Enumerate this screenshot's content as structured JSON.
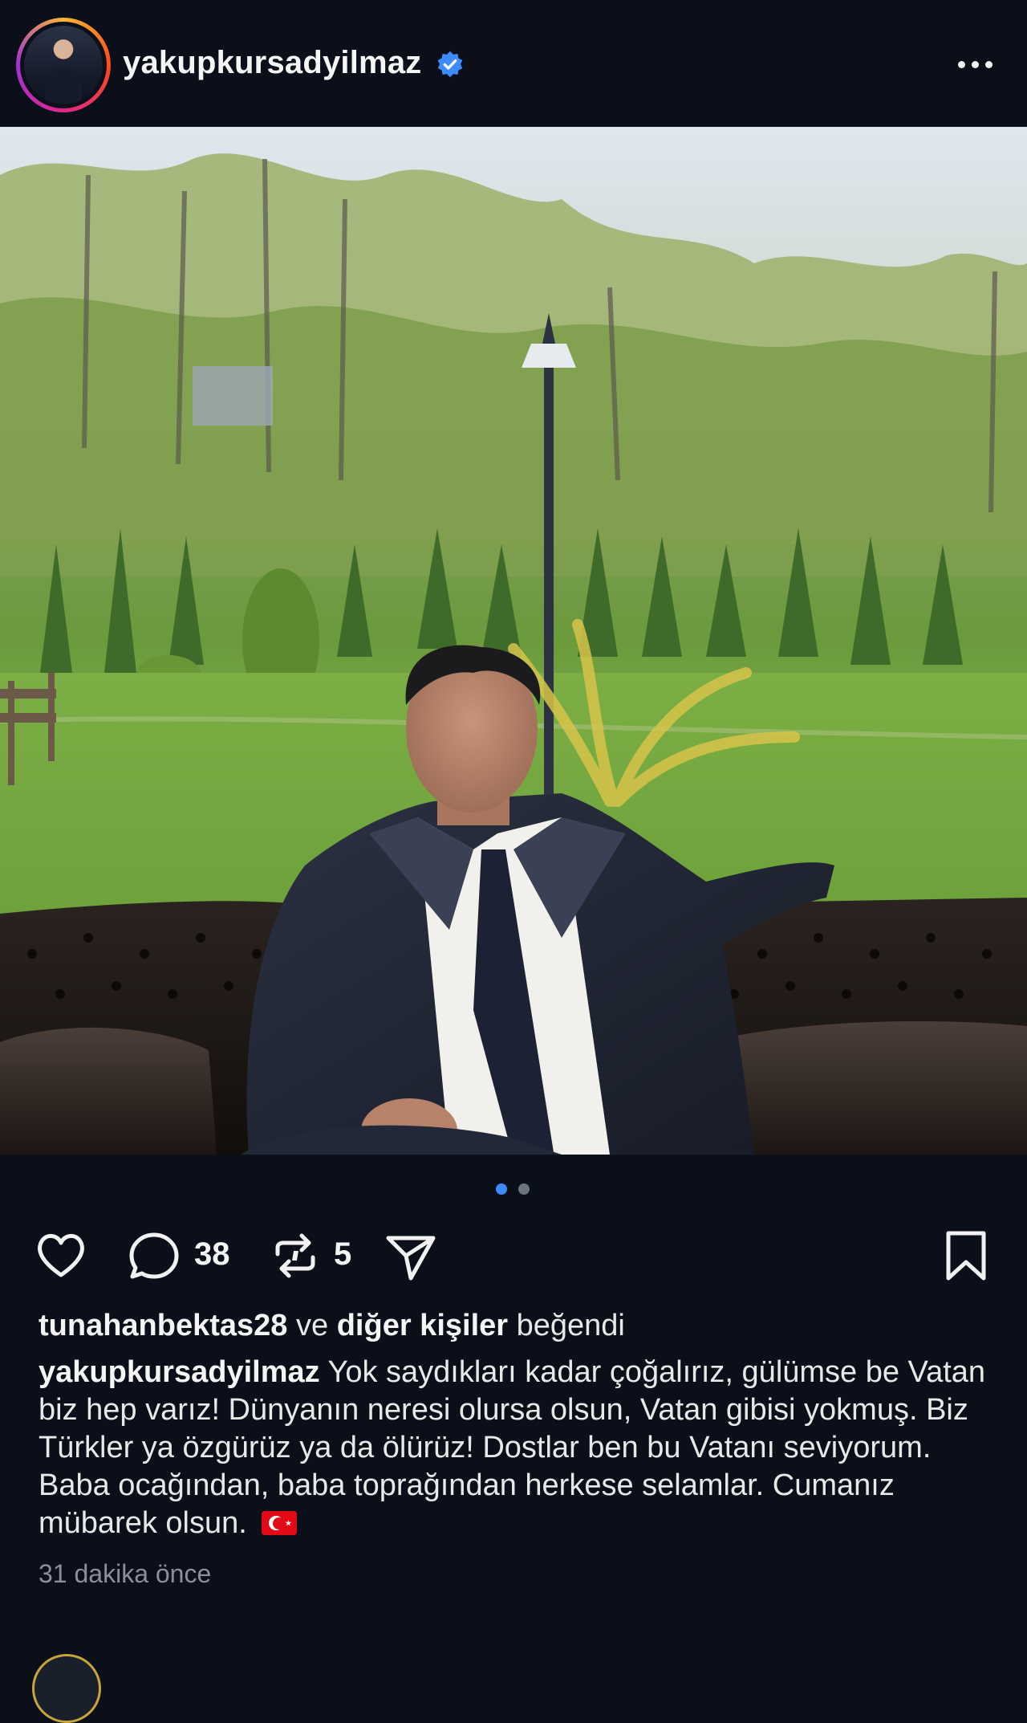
{
  "post": {
    "author": {
      "username": "yakupkursadyilmaz",
      "verified": true,
      "avatar_icon": "profile-photo"
    },
    "more_icon": "more-horizontal-icon",
    "carousel": {
      "current": 1,
      "total": 2
    },
    "actions": {
      "like_icon": "heart-icon",
      "comment_icon": "comment-icon",
      "comments_count": "38",
      "repost_icon": "repost-icon",
      "reposts_count": "5",
      "share_icon": "send-icon",
      "save_icon": "bookmark-icon"
    },
    "likes": {
      "user": "tunahanbektas28",
      "connector": "ve",
      "others": "diğer kişiler",
      "suffix": "beğendi"
    },
    "caption": {
      "username": "yakupkursadyilmaz",
      "text": "Yok saydıkları kadar çoğalırız, gülümse be Vatan biz hep varız! Dünyanın neresi olursa olsun, Vatan gibisi yokmuş. Biz Türkler ya özgürüz ya da ölürüz! Dostlar ben bu Vatanı seviyorum. Baba ocağından, baba toprağından herkese selamlar. Cumanız mübarek olsun.",
      "emoji": "turkey-flag"
    },
    "timestamp": "31 dakika önce"
  },
  "colors": {
    "background": "#0b0f19",
    "accent_blue": "#3d8bfd",
    "text_primary": "#f5f5f5",
    "text_muted": "#8b8f99"
  }
}
